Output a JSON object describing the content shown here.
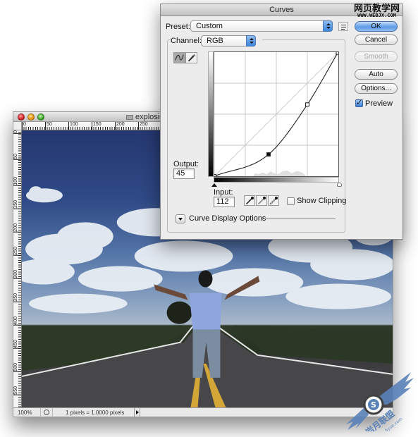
{
  "document_window": {
    "title": "explosion",
    "ruler_h_labels": [
      "0",
      "50",
      "100",
      "150",
      "200",
      "250"
    ],
    "ruler_v_labels": [
      "0",
      "50",
      "100",
      "150",
      "200",
      "250",
      "300",
      "350",
      "400",
      "450",
      "500",
      "550"
    ],
    "status": {
      "zoom": "100%",
      "info": "1 pixels = 1.0000 pixels"
    },
    "image_description": "man with outstretched arms on a road under a cloudy blue sky"
  },
  "curves_dialog": {
    "title": "Curves",
    "preset_label": "Preset:",
    "preset_value": "Custom",
    "channel_label": "Channel:",
    "channel_value": "RGB",
    "output_label": "Output:",
    "output_value": "45",
    "input_label": "Input:",
    "input_value": "112",
    "show_clipping_label": "Show Clipping",
    "show_clipping_checked": false,
    "curve_display_options_label": "Curve Display Options",
    "buttons": {
      "ok": "OK",
      "cancel": "Cancel",
      "smooth": "Smooth",
      "auto": "Auto",
      "options": "Options..."
    },
    "preview_label": "Preview",
    "preview_checked": true,
    "curve_points": [
      {
        "input": 0,
        "output": 0
      },
      {
        "input": 112,
        "output": 45
      },
      {
        "input": 192,
        "output": 148
      },
      {
        "input": 255,
        "output": 255
      }
    ],
    "selected_point_index": 1
  },
  "watermarks": {
    "top_cn": "网页教学网",
    "top_url": "WWW.WEBJX.COM",
    "bottom_cn": "岩月联盟",
    "bottom_url": "www.5yue.com"
  }
}
